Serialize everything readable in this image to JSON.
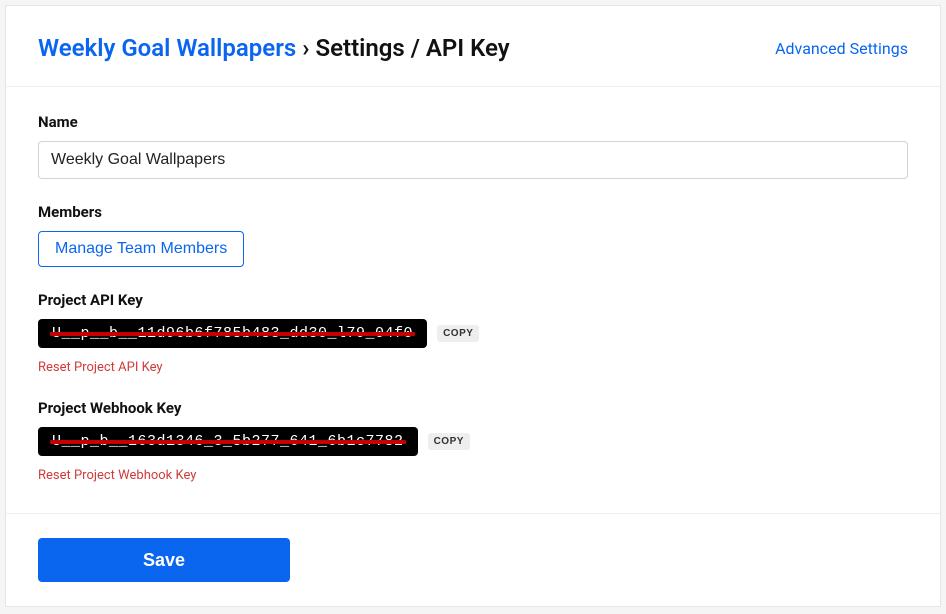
{
  "header": {
    "project_link": "Weekly Goal Wallpapers",
    "separator": "›",
    "page_title": "Settings / API Key",
    "advanced_link": "Advanced Settings"
  },
  "form": {
    "name": {
      "label": "Name",
      "value": "Weekly Goal Wallpapers"
    },
    "members": {
      "label": "Members",
      "button": "Manage Team Members"
    },
    "api_key": {
      "label": "Project API Key",
      "masked_value": "U__p__b__11d96b6f785b483_dd30_l79_04f0",
      "copy_label": "COPY",
      "reset_label": "Reset Project API Key"
    },
    "webhook_key": {
      "label": "Project Webhook Key",
      "masked_value": "U__p_b__163d1346_3_5b277_641_6b1c7782",
      "copy_label": "COPY",
      "reset_label": "Reset Project Webhook Key"
    }
  },
  "footer": {
    "save_label": "Save"
  }
}
